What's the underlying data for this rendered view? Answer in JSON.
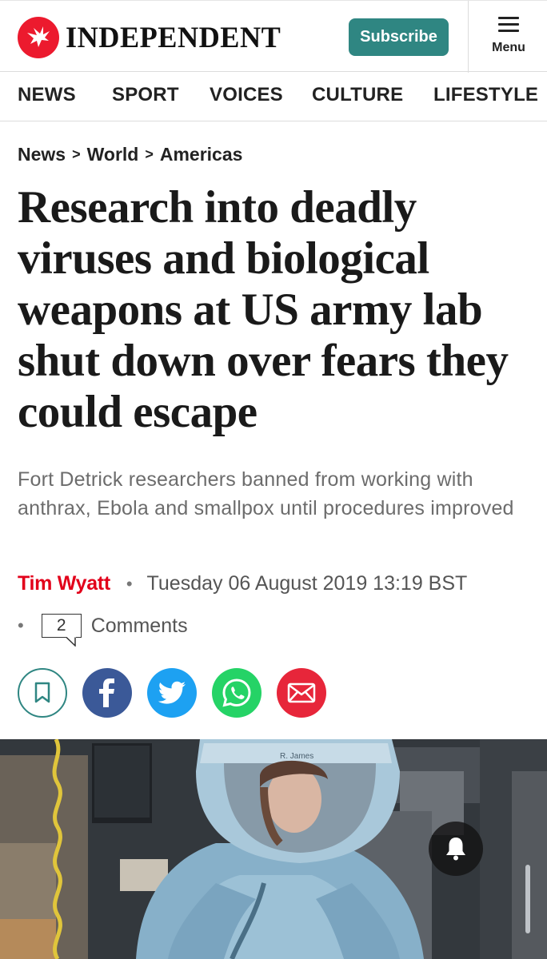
{
  "header": {
    "logo_text": "INDEPENDENT",
    "subscribe_label": "Subscribe",
    "menu_label": "Menu"
  },
  "nav": {
    "items": [
      "NEWS",
      "SPORT",
      "VOICES",
      "CULTURE",
      "LIFESTYLE"
    ]
  },
  "breadcrumb": {
    "items": [
      "News",
      "World",
      "Americas"
    ],
    "separator": ">"
  },
  "article": {
    "headline": "Research into deadly viruses and biological weapons at US army lab shut down over fears they could escape",
    "standfirst": "Fort Detrick researchers banned from working with anthrax, Ebola and smallpox until procedures improved",
    "author": "Tim Wyatt",
    "bullet": "•",
    "date": "Tuesday 06 August 2019 13:19 BST",
    "comment_count": "2",
    "comments_label": "Comments"
  },
  "share": {
    "icons": [
      "bookmark-icon",
      "facebook-icon",
      "twitter-icon",
      "whatsapp-icon",
      "email-icon"
    ]
  },
  "hero": {
    "helmet_label": "R. James"
  },
  "colors": {
    "brand_red": "#ec1a2e",
    "author_red": "#e2001a",
    "subscribe_teal": "#2f8682",
    "bookmark_teal": "#2f8682",
    "facebook": "#3b5998",
    "twitter": "#1da1f2",
    "whatsapp": "#25d366",
    "email": "#e7263a"
  }
}
